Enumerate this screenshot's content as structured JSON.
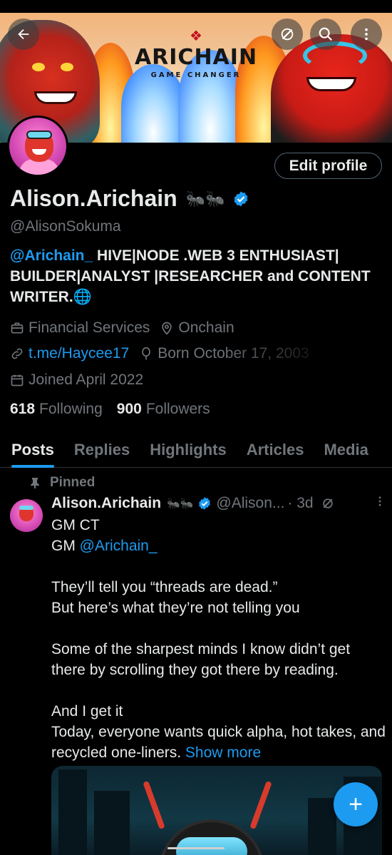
{
  "banner": {
    "logo_title": "ARICHAIN",
    "logo_subtitle": "GAME CHANGER"
  },
  "topbar": {
    "back_icon": "arrow-left-icon",
    "grok_icon": "grok-icon",
    "search_icon": "search-icon",
    "more_icon": "more-vertical-icon"
  },
  "profile": {
    "edit_label": "Edit profile",
    "display_name": "Alison.Arichain",
    "name_emoji": "🐜🐜",
    "handle": "@AlisonSokuma",
    "bio_mention": "@Arichain_",
    "bio_text": " HIVE|NODE .WEB 3 ENTHUSIAST| BUILDER|ANALYST |RESEARCHER and CONTENT WRITER.🌐",
    "category": "Financial Services",
    "location": "Onchain",
    "website": "t.me/Haycee17",
    "birthday": "Born October 17, 2003",
    "joined": "Joined April 2022",
    "following_count": "618",
    "following_label": "Following",
    "followers_count": "900",
    "followers_label": "Followers"
  },
  "tabs": [
    {
      "label": "Posts"
    },
    {
      "label": "Replies"
    },
    {
      "label": "Highlights"
    },
    {
      "label": "Articles"
    },
    {
      "label": "Media"
    }
  ],
  "post": {
    "pinned_label": "Pinned",
    "author_name": "Alison.Arichain",
    "author_emoji": "🐜🐜",
    "author_handle": "@Alison...",
    "time": "· 3d",
    "line1": "GM CT",
    "line2_prefix": "GM ",
    "line2_mention": "@Arichain_",
    "body": "They’ll tell you “threads are dead.”\nBut here’s what they’re not telling you\n\nSome of the sharpest minds I know didn’t get there by scrolling they got there by reading.\n\nAnd I get it\nToday, everyone wants quick alpha, hot takes, and recycled one-liners. ",
    "show_more": "Show more"
  },
  "fab_label": "+",
  "colors": {
    "accent": "#1d9bf0",
    "muted": "#71767b",
    "text": "#e7e9ea",
    "background": "#000000"
  }
}
